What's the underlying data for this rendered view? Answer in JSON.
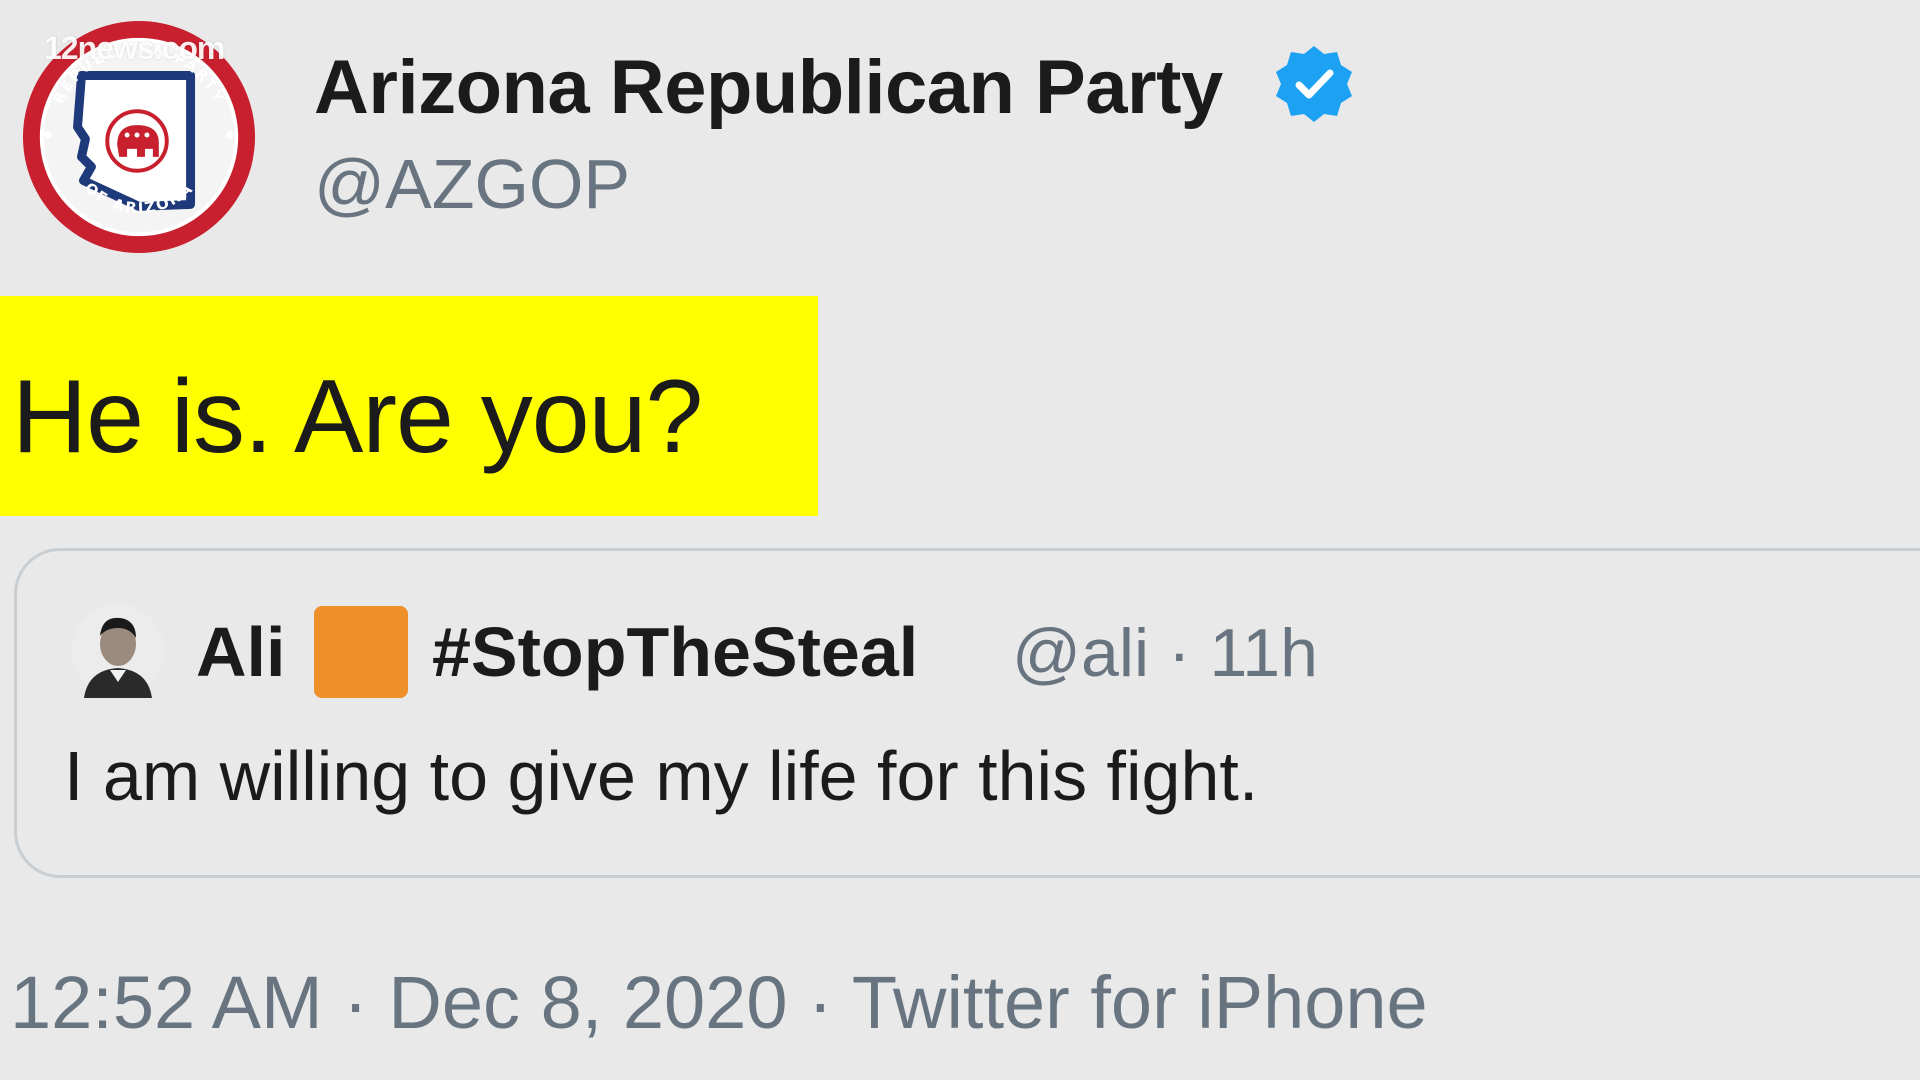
{
  "watermark": "12news.com",
  "tweet": {
    "author_name": "Arizona Republican Party",
    "handle": "@AZGOP",
    "verified_icon": "verified-badge-icon",
    "text": "He is. Are you?",
    "highlight_color": "#ffff00",
    "avatar_logo_text_top": "REPUBLICAN PARTY",
    "avatar_logo_text_bottom": "OF ARIZONA",
    "quoted": {
      "name": "Ali",
      "emoji_square_color": "#ee8f2a",
      "hashtag": "#StopTheSteal",
      "meta": "@ali · 11h",
      "text": "I am willing to give my life for this fight."
    },
    "footer": "12:52 AM · Dec 8, 2020 · Twitter for iPhone"
  },
  "colors": {
    "background": "#e9e9e9",
    "verified_blue": "#1da1f2",
    "secondary_text": "#687580",
    "logo_red": "#c8202f",
    "logo_navy": "#1f3a7a"
  }
}
